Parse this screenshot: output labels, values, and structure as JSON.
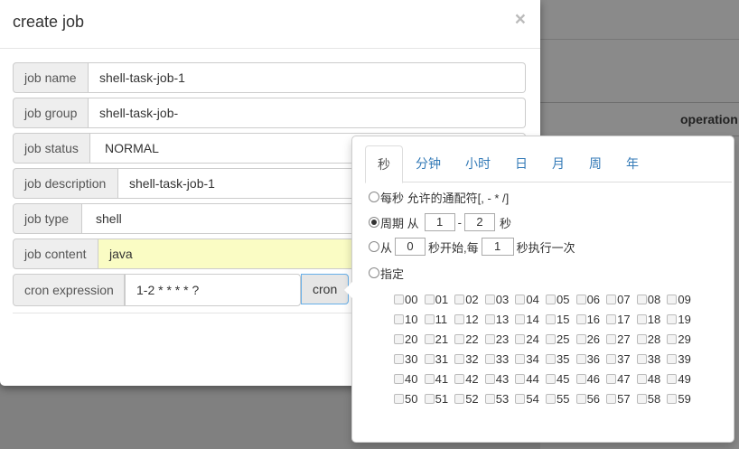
{
  "background": {
    "operation_header": "operation"
  },
  "modal": {
    "title": "create job",
    "close": "×",
    "fields": [
      {
        "label": "job name",
        "value": "shell-task-job-1"
      },
      {
        "label": "job group",
        "value": "shell-task-job-"
      },
      {
        "label": "job status",
        "value": "NORMAL"
      },
      {
        "label": "job description",
        "value": "shell-task-job-1"
      },
      {
        "label": "job type",
        "value": "shell"
      },
      {
        "label": "job content",
        "value": "java"
      },
      {
        "label": "cron expression",
        "value": "1-2 * * * * ?"
      }
    ],
    "cron_button": "cron"
  },
  "cron_popover": {
    "tabs": [
      "秒",
      "分钟",
      "小时",
      "日",
      "月",
      "周",
      "年"
    ],
    "active_tab": "秒",
    "options": {
      "every": "每秒 允许的通配符[, - * /]",
      "cycle_prefix": "周期 从",
      "cycle_from": "1",
      "cycle_sep": "-",
      "cycle_to": "2",
      "cycle_unit": "秒",
      "start_prefix": "从",
      "start_from": "0",
      "start_mid": "秒开始,每",
      "start_every": "1",
      "start_suffix": "秒执行一次",
      "specify": "指定"
    },
    "selected_option": "cycle",
    "seconds": [
      [
        "00",
        "01",
        "02",
        "03",
        "04",
        "05",
        "06",
        "07",
        "08",
        "09"
      ],
      [
        "10",
        "11",
        "12",
        "13",
        "14",
        "15",
        "16",
        "17",
        "18",
        "19"
      ],
      [
        "20",
        "21",
        "22",
        "23",
        "24",
        "25",
        "26",
        "27",
        "28",
        "29"
      ],
      [
        "30",
        "31",
        "32",
        "33",
        "34",
        "35",
        "36",
        "37",
        "38",
        "39"
      ],
      [
        "40",
        "41",
        "42",
        "43",
        "44",
        "45",
        "46",
        "47",
        "48",
        "49"
      ],
      [
        "50",
        "51",
        "52",
        "53",
        "54",
        "55",
        "56",
        "57",
        "58",
        "59"
      ]
    ]
  }
}
